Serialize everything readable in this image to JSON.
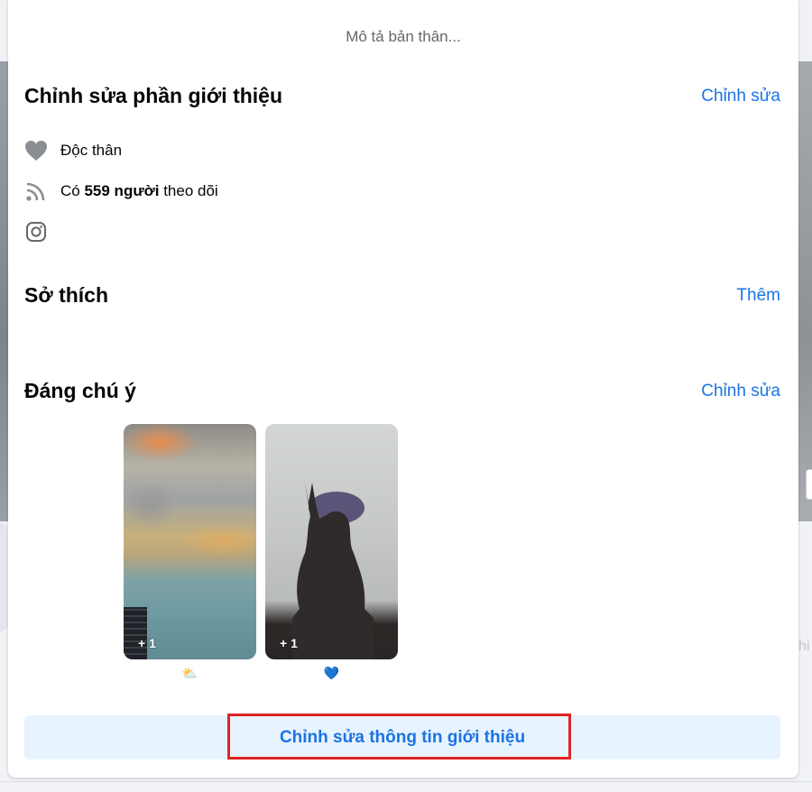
{
  "intro": {
    "bio_placeholder": "Mô tả bản thân...",
    "title": "Chỉnh sửa phần giới thiệu",
    "edit_link": "Chỉnh sửa",
    "relationship_status": "Độc thân",
    "followers_prefix": "Có",
    "followers_count": "559 người",
    "followers_suffix": "theo dõi"
  },
  "hobbies": {
    "title": "Sở thích",
    "add_link": "Thêm"
  },
  "featured": {
    "title": "Đáng chú ý",
    "edit_link": "Chỉnh sửa",
    "items": [
      {
        "count_label": "+ 1",
        "caption": "⛅"
      },
      {
        "count_label": "+ 1",
        "caption": "💙"
      }
    ]
  },
  "footer": {
    "edit_details_button": "Chỉnh sửa thông tin giới thiệu"
  },
  "background": {
    "right_fragment": "hi"
  },
  "colors": {
    "link": "#1b74e4",
    "button_bg": "#e7f3ff",
    "highlight": "#e02424",
    "icon_gray": "#65676b"
  }
}
